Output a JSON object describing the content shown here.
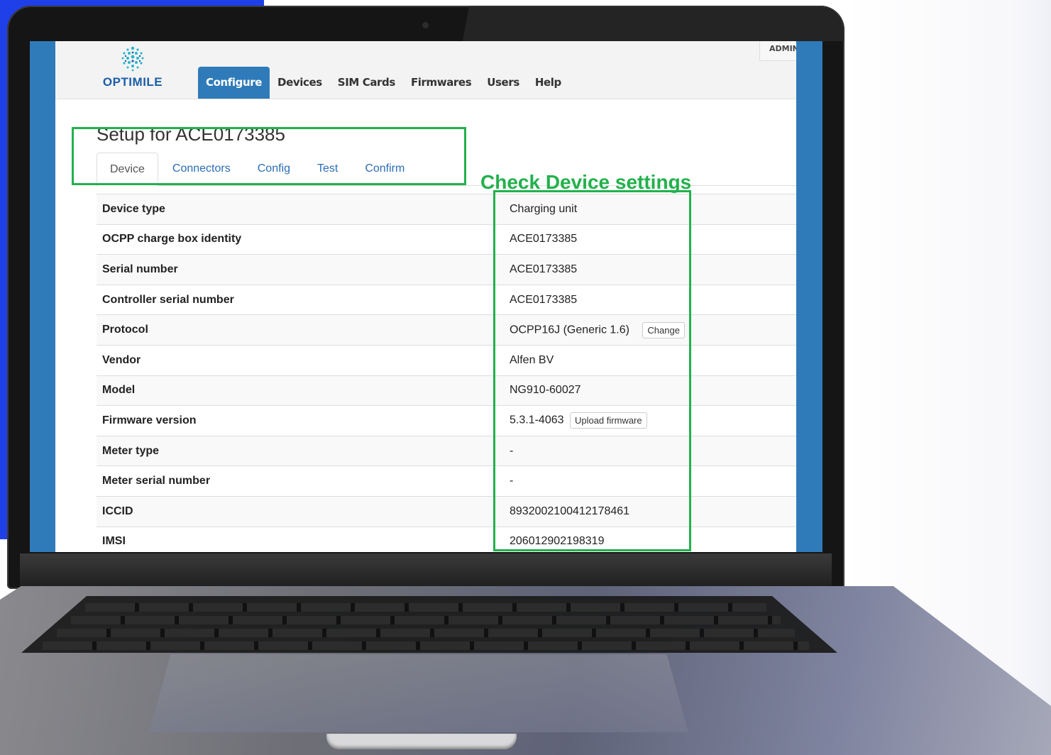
{
  "app": {
    "logo_text": "OPTIMILE",
    "admin_label": "ADMIN",
    "nav": [
      {
        "label": "Configure",
        "active": true
      },
      {
        "label": "Devices"
      },
      {
        "label": "SIM Cards"
      },
      {
        "label": "Firmwares"
      },
      {
        "label": "Users"
      },
      {
        "label": "Help"
      }
    ]
  },
  "page": {
    "title": "Setup for ACE0173385",
    "tabs": [
      {
        "label": "Device",
        "active": true
      },
      {
        "label": "Connectors"
      },
      {
        "label": "Config"
      },
      {
        "label": "Test"
      },
      {
        "label": "Confirm"
      }
    ]
  },
  "device_table": [
    {
      "key": "Device type",
      "value": "Charging unit"
    },
    {
      "key": "OCPP charge box identity",
      "value": "ACE0173385"
    },
    {
      "key": "Serial number",
      "value": "ACE0173385"
    },
    {
      "key": "Controller serial number",
      "value": "ACE0173385"
    },
    {
      "key": "Protocol",
      "value": "OCPP16J (Generic 1.6)",
      "button": "Change"
    },
    {
      "key": "Vendor",
      "value": "Alfen BV"
    },
    {
      "key": "Model",
      "value": "NG910-60027"
    },
    {
      "key": "Firmware version",
      "value": "5.3.1-4063",
      "button": "Upload firmware"
    },
    {
      "key": "Meter type",
      "value": "-"
    },
    {
      "key": "Meter serial number",
      "value": "-"
    },
    {
      "key": "ICCID",
      "value": "8932002100412178461"
    },
    {
      "key": "IMSI",
      "value": "206012902198319"
    }
  ],
  "annotation": {
    "label": "Check Device settings",
    "color": "#22b14c"
  },
  "colors": {
    "primary": "#2f7bb9",
    "link": "#2a6db5",
    "backdrop": "#1f3fe8"
  }
}
